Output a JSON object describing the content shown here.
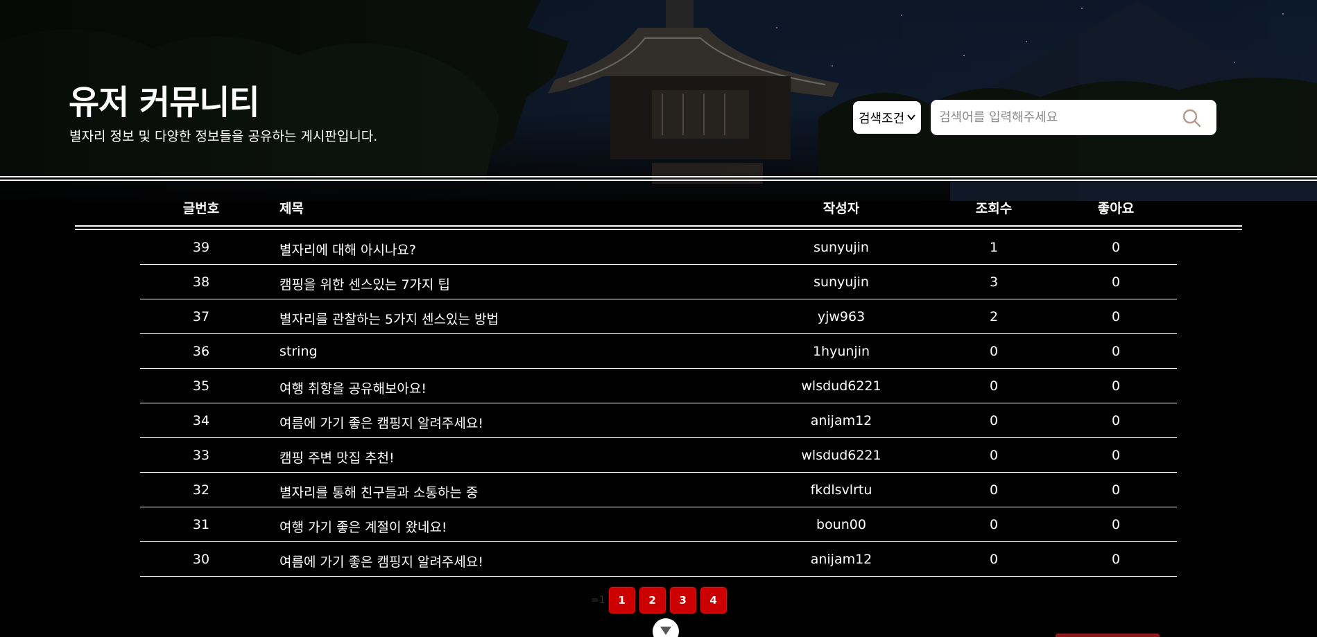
{
  "header": {
    "title": "유저 커뮤니티",
    "subtitle": "별자리 정보 및 다양한 정보들을 공유하는 게시판입니다."
  },
  "search": {
    "condition_label": "검색조건",
    "placeholder": "검색어를 입력해주세요",
    "value": ""
  },
  "table": {
    "headers": {
      "no": "글번호",
      "title": "제목",
      "author": "작성자",
      "views": "조회수",
      "likes": "좋아요"
    },
    "rows": [
      {
        "no": "39",
        "title": "별자리에 대해 아시나요?",
        "author": "sunyujin",
        "views": "1",
        "likes": "0"
      },
      {
        "no": "38",
        "title": "캠핑을 위한 센스있는 7가지 팁",
        "author": "sunyujin",
        "views": "3",
        "likes": "0"
      },
      {
        "no": "37",
        "title": "별자리를 관찰하는 5가지 센스있는 방법",
        "author": "yjw963",
        "views": "2",
        "likes": "0"
      },
      {
        "no": "36",
        "title": "string",
        "author": "1hyunjin",
        "views": "0",
        "likes": "0"
      },
      {
        "no": "35",
        "title": "여행 취향을 공유해보아요!",
        "author": "wlsdud6221",
        "views": "0",
        "likes": "0"
      },
      {
        "no": "34",
        "title": "여름에 가기 좋은 캠핑지 알려주세요!",
        "author": "anijam12",
        "views": "0",
        "likes": "0"
      },
      {
        "no": "33",
        "title": "캠핑 주변 맛집 추천!",
        "author": "wlsdud6221",
        "views": "0",
        "likes": "0"
      },
      {
        "no": "32",
        "title": "별자리를 통해 친구들과 소통하는 중",
        "author": "fkdlsvlrtu",
        "views": "0",
        "likes": "0"
      },
      {
        "no": "31",
        "title": "여행 가기 좋은 계절이 왔네요!",
        "author": "boun00",
        "views": "0",
        "likes": "0"
      },
      {
        "no": "30",
        "title": "여름에 가기 좋은 캠핑지 알려주세요!",
        "author": "anijam12",
        "views": "0",
        "likes": "0"
      }
    ]
  },
  "pagination": {
    "prefix": "=1",
    "pages": [
      "1",
      "2",
      "3",
      "4"
    ]
  },
  "colors": {
    "background": "#000000",
    "page_button": "#cc0000",
    "write_button": "#8b1a1a"
  },
  "icons": {
    "search": "search-icon",
    "select_arrow": "chevron-down-icon",
    "scroll_down": "chevron-down-icon"
  }
}
